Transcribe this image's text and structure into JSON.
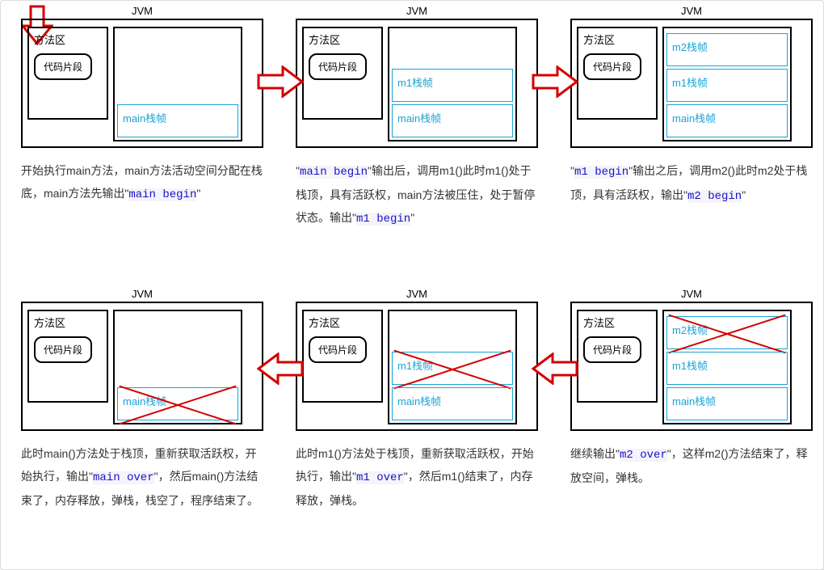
{
  "common": {
    "jvm": "JVM",
    "method_area": "方法区",
    "code_segment": "代码片段"
  },
  "frames": {
    "main": "main栈帧",
    "m1": "m1栈帧",
    "m2": "m2栈帧"
  },
  "steps": [
    {
      "stack": [
        "main"
      ],
      "crossed": [],
      "desc_parts": [
        "开始执行main方法，main方法活动空间分配在栈底，main方法先输出\"",
        "main begin",
        "\""
      ]
    },
    {
      "stack": [
        "m1",
        "main"
      ],
      "crossed": [],
      "desc_parts": [
        "\"",
        "main begin",
        "\"输出后，调用m1()此时m1()处于栈顶，具有活跃权，main方法被压住，处于暂停状态。输出\"",
        "m1 begin",
        "\""
      ]
    },
    {
      "stack": [
        "m2",
        "m1",
        "main"
      ],
      "crossed": [],
      "desc_parts": [
        "\"",
        "m1 begin",
        "\"输出之后，调用m2()此时m2处于栈顶，具有活跃权，输出\"",
        "m2 begin",
        "\""
      ]
    },
    {
      "stack": [
        "m2",
        "m1",
        "main"
      ],
      "crossed": [
        "m2"
      ],
      "desc_parts": [
        "继续输出\"",
        "m2 over",
        "\"，这样m2()方法结束了，释放空间，弹栈。"
      ]
    },
    {
      "stack": [
        "m1",
        "main"
      ],
      "crossed": [
        "m1"
      ],
      "desc_parts": [
        "此时m1()方法处于栈顶，重新获取活跃权，开始执行，输出\"",
        "m1 over",
        "\"，然后m1()结束了，内存释放，弹栈。"
      ]
    },
    {
      "stack": [
        "main"
      ],
      "crossed": [
        "main"
      ],
      "desc_parts": [
        "此时main()方法处于栈顶，重新获取活跃权，开始执行，输出\"",
        "main over",
        "\"，然后main()方法结束了，内存释放，弹栈，栈空了，程序结束了。"
      ]
    }
  ],
  "chart_data": {
    "type": "diagram",
    "title": "JVM stack frame lifecycle during main → m1 → m2 calls",
    "nodes": [
      {
        "id": 1,
        "stack": [
          "main栈帧"
        ],
        "output": "main begin"
      },
      {
        "id": 2,
        "stack": [
          "m1栈帧",
          "main栈帧"
        ],
        "output": "m1 begin"
      },
      {
        "id": 3,
        "stack": [
          "m2栈帧",
          "m1栈帧",
          "main栈帧"
        ],
        "output": "m2 begin"
      },
      {
        "id": 4,
        "stack": [
          "m2栈帧(X)",
          "m1栈帧",
          "main栈帧"
        ],
        "output": "m2 over"
      },
      {
        "id": 5,
        "stack": [
          "m1栈帧(X)",
          "main栈帧"
        ],
        "output": "m1 over"
      },
      {
        "id": 6,
        "stack": [
          "main栈帧(X)"
        ],
        "output": "main over"
      }
    ],
    "edges": [
      {
        "from": 1,
        "to": 2,
        "direction": "right"
      },
      {
        "from": 2,
        "to": 3,
        "direction": "right"
      },
      {
        "from": 3,
        "to": 4,
        "direction": "down"
      },
      {
        "from": 4,
        "to": 5,
        "direction": "left"
      },
      {
        "from": 5,
        "to": 6,
        "direction": "left"
      }
    ]
  }
}
